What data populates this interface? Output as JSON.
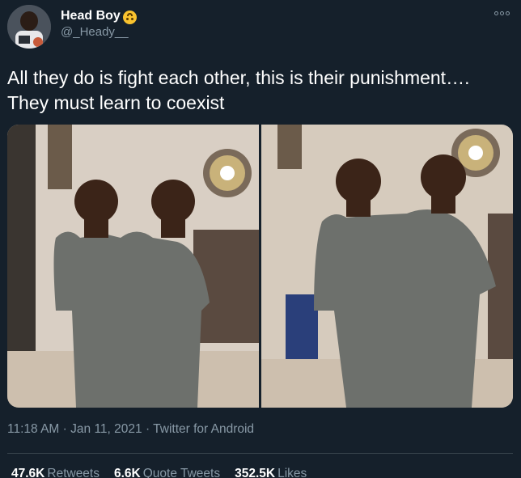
{
  "author": {
    "display_name": "Head Boy",
    "handle": "@_Heady__",
    "badge_icon": "upside-down-face-emoji-icon"
  },
  "more_icon": "more-options-icon",
  "tweet": {
    "text": "All they do is fight each other, this is their punishment…. They must learn to coexist"
  },
  "meta": {
    "time": "11:18 AM",
    "date": "Jan 11, 2021",
    "client": "Twitter for Android",
    "separator": "·"
  },
  "stats": {
    "retweets_count": "47.6K",
    "retweets_label": "Retweets",
    "quotes_count": "6.6K",
    "quotes_label": "Quote Tweets",
    "likes_count": "352.5K",
    "likes_label": "Likes"
  },
  "colors": {
    "background": "#15202b",
    "secondary_text": "#8899a6",
    "divider": "#38444d"
  }
}
